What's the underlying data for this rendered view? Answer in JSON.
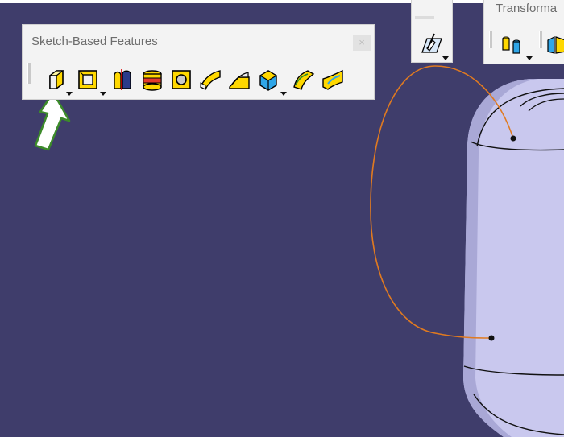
{
  "colors": {
    "viewport_background": "#3f3d6b",
    "toolbar_background": "#f3f3f3",
    "spline_color": "#e07a20",
    "solid_body": "#c9c8ee",
    "arrow_outline": "#3c8a2a"
  },
  "sketch_based_features": {
    "title": "Sketch-Based Features",
    "close_glyph": "×",
    "tools": [
      {
        "name": "pad-icon",
        "has_dropdown": true
      },
      {
        "name": "pocket-icon",
        "has_dropdown": true
      },
      {
        "name": "shaft-icon",
        "has_dropdown": false
      },
      {
        "name": "groove-icon",
        "has_dropdown": false
      },
      {
        "name": "hole-icon",
        "has_dropdown": false
      },
      {
        "name": "rib-icon",
        "has_dropdown": false
      },
      {
        "name": "slot-icon",
        "has_dropdown": false
      },
      {
        "name": "stiffener-icon",
        "has_dropdown": true
      },
      {
        "name": "multi-sections-solid-icon",
        "has_dropdown": false
      },
      {
        "name": "removed-multi-sections-solid-icon",
        "has_dropdown": false
      }
    ]
  },
  "sketcher_toolbar": {
    "tool": "sketch-icon",
    "has_dropdown": true
  },
  "transformations_toolbar": {
    "title": "Transforma",
    "tools": [
      "translation-icon",
      "mirror-icon"
    ]
  },
  "annotation": {
    "pointer": "green-pointer-arrow-icon",
    "points_to": "pad-icon"
  }
}
